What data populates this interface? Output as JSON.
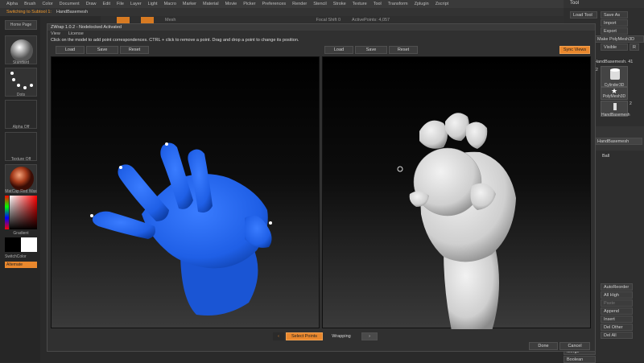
{
  "menubar": {
    "items": [
      "Alpha",
      "Brush",
      "Color",
      "Document",
      "Draw",
      "Edit",
      "File",
      "Layer",
      "Light",
      "Macro",
      "Marker",
      "Material",
      "Movie",
      "Picker",
      "Preferences",
      "Render",
      "Stencil",
      "Stroke",
      "Texture",
      "Tool",
      "Transform",
      "Zplugin",
      "Zscript"
    ]
  },
  "status": {
    "switching": "Switching to Subtool 1:",
    "mesh_name": "HandBasemesh"
  },
  "topbar": {
    "mesh": "Mesh",
    "focal": "Focal Shift 0",
    "active_points": "ActivePoints: 4,057"
  },
  "left_shelf": {
    "home_page": "Home Page",
    "brush_label": "Standard",
    "stroke_label": "Dots",
    "alpha_label": "Alpha Off",
    "texture_label": "Texture Off",
    "material_label": "MatCap Red Wax",
    "gradient_label": "Gradient",
    "switch_color": "SwitchColor",
    "alternate": "Alternate"
  },
  "right_panel": {
    "title": "Tool",
    "load_tool": "Load Tool",
    "save_as": "Save As",
    "import": "Import",
    "export": "Export",
    "clone": "Clone",
    "make_polymesh": "Make PolyMesh3D",
    "goz": "GoZ",
    "all": "All",
    "visible": "Visible",
    "r": "R",
    "lightbox_tools": "Lightbox > Tools",
    "mesh_count": "HandBasemesh. 41",
    "num_2a": "2",
    "cylinder": "Cylinder3D",
    "polymesh": "PolyMesh3D",
    "num_2b": "2",
    "handbasemesh": "HandBasemesh",
    "subtool": "Subtool",
    "handbasemesh2": "HandBasemesh",
    "ball": "Ball",
    "autoreorder": "AutoReorder",
    "all_high": "All High",
    "paste": "Paste",
    "append": "Append",
    "insert": "Insert",
    "del_other": "Del Other",
    "del_all": "Del All",
    "split": "Split",
    "merge": "Merge",
    "boolean": "Boolean"
  },
  "dialog": {
    "title": "ZWrap 1.0.2 - Nodelocked Activated",
    "menu_view": "View",
    "menu_license": "License",
    "instructions": "Click on the model to add point correspondences. CTRL + click to remove a point. Drag and drop a point to change its position.",
    "left_load": "Load",
    "left_save": "Save",
    "left_reset": "Reset",
    "right_load": "Load",
    "right_save": "Save",
    "right_reset": "Reset",
    "sync_views": "Sync Views",
    "prev_arrow": "‹",
    "select_points": "Select Points",
    "wrapping": "Wrapping",
    "next_arrow": "›",
    "done": "Done",
    "cancel": "Cancel"
  },
  "colors": {
    "accent_orange": "#e9872d",
    "hand_blue": "#1f5fe6",
    "sculpt_gray": "#e2e2e2"
  }
}
